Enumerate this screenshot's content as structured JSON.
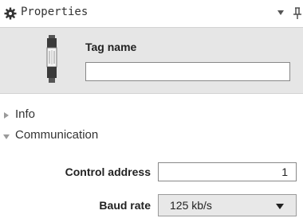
{
  "panel": {
    "title": "Properties",
    "icons": {
      "settings": "gear-icon",
      "menu": "chevron-down-icon",
      "pin": "pin-icon"
    }
  },
  "tag": {
    "label": "Tag name",
    "value": "",
    "device_icon": "device-module-icon"
  },
  "sections": [
    {
      "label": "Info",
      "expanded": false
    },
    {
      "label": "Communication",
      "expanded": true
    }
  ],
  "communication": {
    "control_address_label": "Control address",
    "control_address_value": "1",
    "baud_rate_label": "Baud rate",
    "baud_rate_value": "125 kb/s"
  },
  "colors": {
    "tag_panel_bg": "#e6e6e6",
    "select_bg": "#e8e8e8"
  }
}
